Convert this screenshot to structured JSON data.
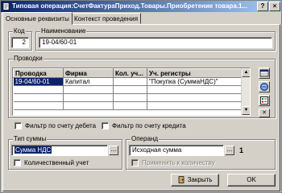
{
  "window": {
    "title": "Типовая операция:СчетФактураПриход.Товары.Приобретение товара.1...",
    "help_btn": "?",
    "close_btn": "×"
  },
  "tabs": [
    {
      "label": "Основные реквизиты",
      "active": true
    },
    {
      "label": "Контекст проведения",
      "active": false
    }
  ],
  "header": {
    "code_label": "Код",
    "code_value": "2",
    "name_label": "Наименование",
    "name_value": "19-04/60-01"
  },
  "postings": {
    "group_label": "Проводки",
    "columns": [
      "Проводка",
      "Фирма",
      "Кол. уч...",
      "Уч. регистры"
    ],
    "rows": [
      [
        "19-04/60-01",
        "Капитал",
        "",
        "\"Покупка (СуммаНДС)\""
      ],
      [
        "",
        "",
        "",
        ""
      ],
      [
        "",
        "",
        "",
        ""
      ],
      [
        "",
        "",
        "",
        ""
      ]
    ]
  },
  "filters": {
    "debit_label": "Фильтр по счету дебета",
    "credit_label": "Фильтр по счету кредита"
  },
  "sum_type": {
    "group_label": "Тип суммы",
    "value": "Сумма НДС",
    "quantity_label": "Количественный учет"
  },
  "operand": {
    "group_label": "Операнд",
    "value": "Исходная сумма",
    "index": "1",
    "apply_qty_label": "Применить к количеству"
  },
  "buttons": {
    "close_label": "Закрыть",
    "ok_label": "OK"
  },
  "colors": {
    "title_start": "#0a246a",
    "title_end": "#a6caf0",
    "face": "#d4d0c8",
    "selection": "#0a246a"
  }
}
